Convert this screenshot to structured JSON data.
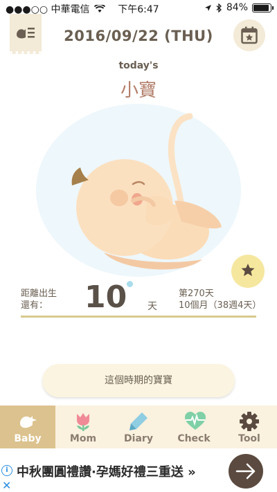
{
  "status_bar": {
    "carrier": "●●●○○ 中華電信",
    "time": "下午6:47",
    "battery": "84%",
    "battery_level": 0.84
  },
  "header": {
    "date": "2016/09/22 (THU)",
    "menu_icon": "menu-list-icon",
    "calendar_icon": "calendar-star-icon"
  },
  "today": {
    "label": "today's",
    "name": "小寶"
  },
  "countdown": {
    "label": "距離出生\n還有：",
    "days": "10",
    "unit": "天",
    "week_day": "第270天",
    "month_week": "10個月（38週4天）"
  },
  "period_button": "這個時期的寶寶",
  "tabs": [
    {
      "label": "Baby",
      "icon": "bird-icon",
      "active": true
    },
    {
      "label": "Mom",
      "icon": "tulip-icon",
      "active": false
    },
    {
      "label": "Diary",
      "icon": "pencil-icon",
      "active": false
    },
    {
      "label": "Check",
      "icon": "heartbeat-icon",
      "active": false
    },
    {
      "label": "Tool",
      "icon": "gear-icon",
      "active": false
    }
  ],
  "ad": {
    "text": "中秋團圓禮讚·孕媽好禮三重送 »",
    "info_icon": "info-icon",
    "close_icon": "close-icon",
    "arrow_icon": "arrow-right-icon"
  },
  "colors": {
    "accent": "#dcc28e",
    "tab_bg": "#faf1df",
    "name_color": "#b27c68",
    "star_bg": "#f6e79f"
  }
}
